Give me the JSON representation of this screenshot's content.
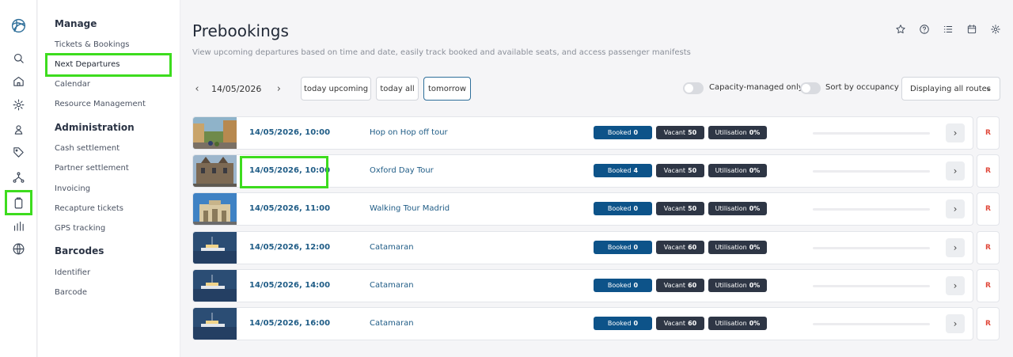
{
  "rail": {
    "icons": [
      "logo-icon",
      "search-icon",
      "home-icon",
      "gear-icon",
      "user-location-icon",
      "tag-icon",
      "network-icon",
      "clipboard-icon",
      "bar-chart-icon",
      "globe-icon"
    ]
  },
  "menu": {
    "sections": [
      {
        "title": "Manage",
        "items": [
          "Tickets & Bookings",
          "Next Departures",
          "Calendar",
          "Resource Management"
        ]
      },
      {
        "title": "Administration",
        "items": [
          "Cash settlement",
          "Partner settlement",
          "Invoicing",
          "Recapture tickets",
          "GPS tracking"
        ]
      },
      {
        "title": "Barcodes",
        "items": [
          "Identifier",
          "Barcode"
        ]
      }
    ]
  },
  "page": {
    "title": "Prebookings",
    "subtitle": "View upcoming departures based on time and date, easily track booked and available seats, and access passenger manifests"
  },
  "header_icons": [
    "star-icon",
    "help-icon",
    "list-icon",
    "calendar-icon",
    "gear-icon"
  ],
  "filters": {
    "date": "14/05/2026",
    "prev": "‹",
    "next": "›",
    "today_upcoming": "today upcoming",
    "today_all": "today all",
    "tomorrow": "tomorrow",
    "capacity_only": "Capacity-managed only",
    "sort_by_occupancy": "Sort by occupancy",
    "routes_select": "Displaying all routes",
    "select_chevron": "⌄"
  },
  "labels": {
    "booked": "Booked",
    "vacant": "Vacant",
    "utilisation": "Utilisation",
    "go": "›",
    "r": "R"
  },
  "departures": [
    {
      "time": "14/05/2026, 10:00",
      "route": "Hop on Hop off tour",
      "booked": "0",
      "vacant": "50",
      "utilisation": "0%",
      "image": "city-street"
    },
    {
      "time": "14/05/2026, 10:00",
      "route": "Oxford Day Tour",
      "booked": "4",
      "vacant": "50",
      "utilisation": "0%",
      "image": "oxford-building"
    },
    {
      "time": "14/05/2026, 11:00",
      "route": "Walking Tour Madrid",
      "booked": "0",
      "vacant": "50",
      "utilisation": "0%",
      "image": "madrid-gate"
    },
    {
      "time": "14/05/2026, 12:00",
      "route": "Catamaran",
      "booked": "0",
      "vacant": "60",
      "utilisation": "0%",
      "image": "catamaran"
    },
    {
      "time": "14/05/2026, 14:00",
      "route": "Catamaran",
      "booked": "0",
      "vacant": "60",
      "utilisation": "0%",
      "image": "catamaran"
    },
    {
      "time": "14/05/2026, 16:00",
      "route": "Catamaran",
      "booked": "0",
      "vacant": "60",
      "utilisation": "0%",
      "image": "catamaran"
    }
  ],
  "colors": {
    "highlight": "#3ddc1e",
    "booked_badge": "#0d5389",
    "dark_badge": "#2e3645",
    "link": "#1f5c86",
    "r_button": "#e0493b"
  }
}
